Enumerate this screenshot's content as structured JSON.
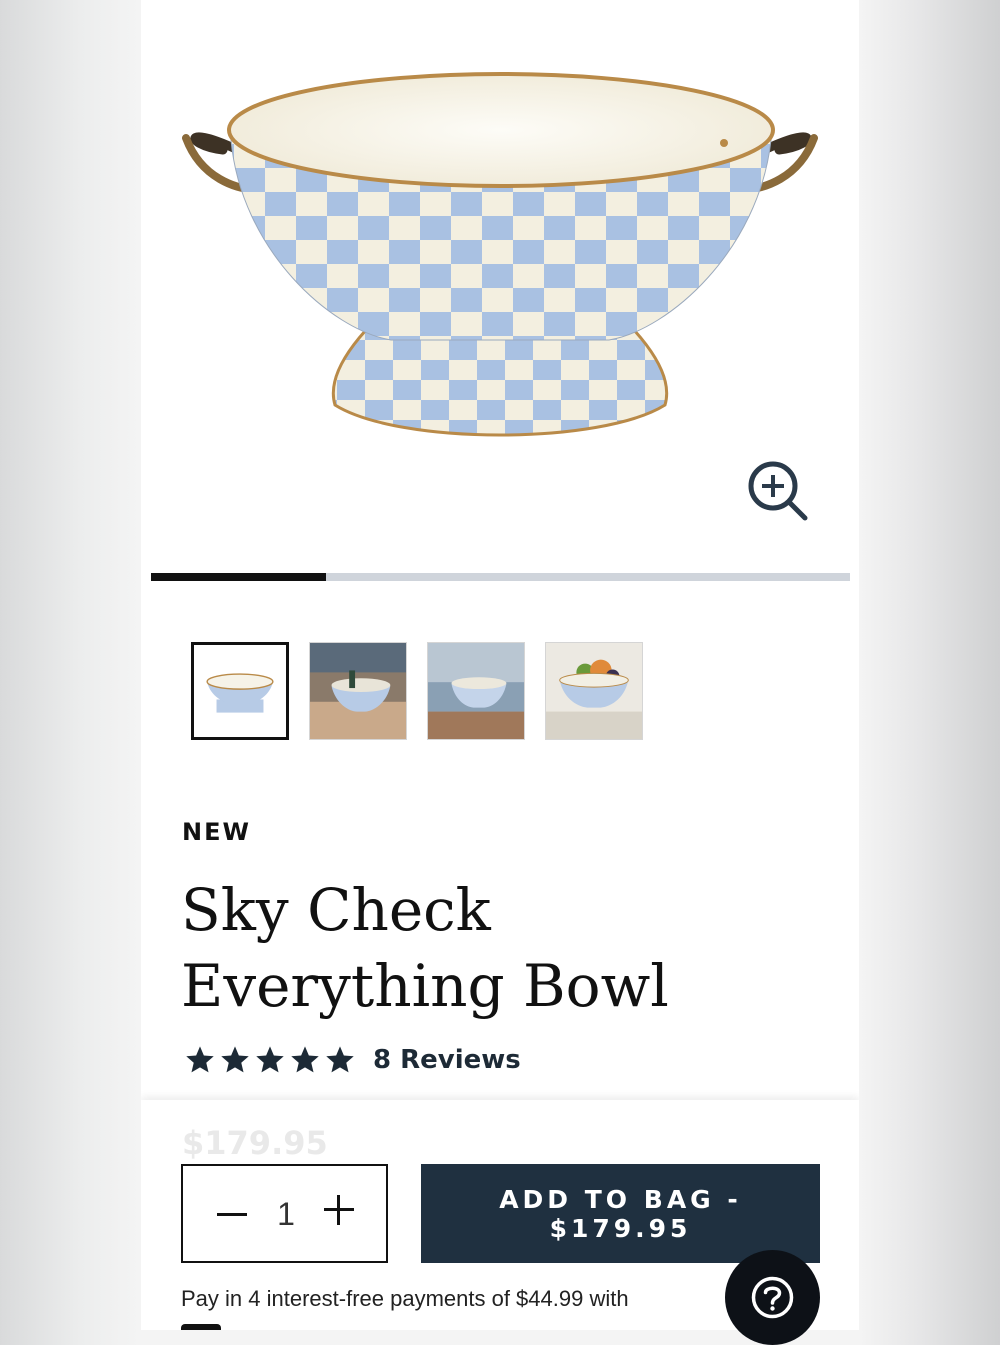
{
  "product": {
    "badge": "NEW",
    "title": "Sky Check Everything Bowl",
    "rating": {
      "stars": 5,
      "reviews_label": "8 Reviews"
    },
    "price_ghost": "$179.95"
  },
  "gallery": {
    "progress_fraction": 0.25,
    "thumbnails": [
      "bowl-product",
      "bowl-table-scene",
      "bowl-bar-scene",
      "bowl-fruit-scene"
    ],
    "selected_index": 0
  },
  "purchase": {
    "quantity": "1",
    "add_to_bag_label": "ADD TO BAG - $179.95",
    "installments_text": "Pay in 4 interest-free payments of $44.99 with"
  },
  "icons": {
    "zoom": "zoom-in-icon",
    "help": "question-mark-icon",
    "star": "star-icon"
  },
  "colors": {
    "check_blue": "#a9c1e2",
    "check_cream": "#f3efe0",
    "brass": "#b98a48",
    "button_navy": "#1f3040",
    "rating_navy": "#1d2a36"
  }
}
